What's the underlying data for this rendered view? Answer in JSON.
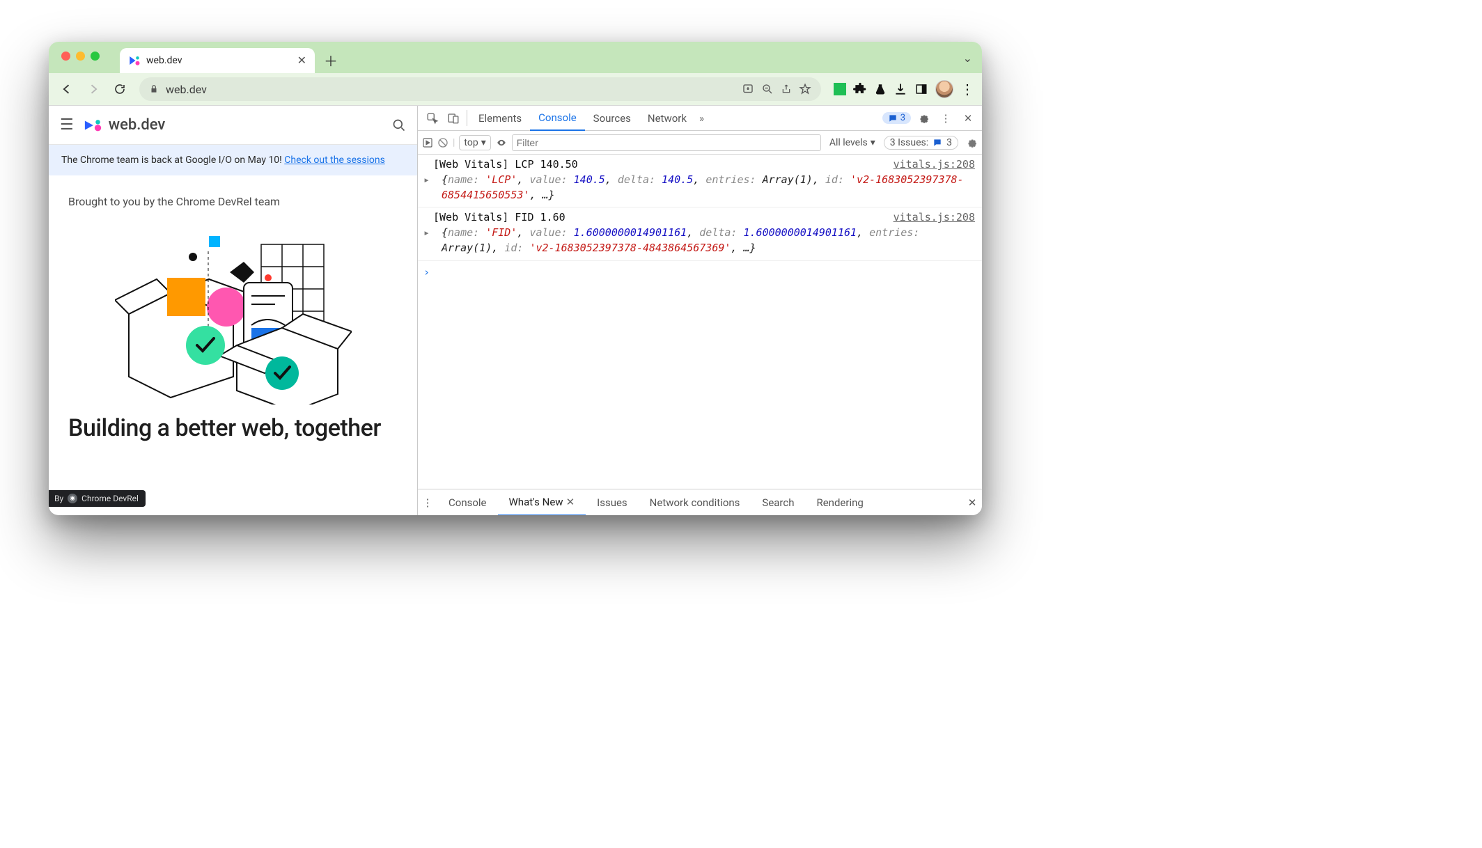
{
  "browser": {
    "tab_title": "web.dev",
    "omnibox_text": "web.dev",
    "lock_label": "Secure",
    "icons": {
      "back": "back-icon",
      "forward": "forward-icon",
      "reload": "reload-icon",
      "install": "install-icon",
      "zoom": "zoom-out-icon",
      "share": "share-icon",
      "star": "star-icon",
      "extension_square": "extension-square-icon",
      "extensions_puzzle": "puzzle-icon",
      "labs": "flask-icon",
      "downloads": "download-icon",
      "window_toggle": "panel-icon",
      "menu": "kebab-icon"
    }
  },
  "page": {
    "brand": "web.dev",
    "banner_text": "The Chrome team is back at Google I/O on May 10! ",
    "banner_link": "Check out the sessions",
    "kicker": "Brought to you by the Chrome DevRel team",
    "heading": "Building a better web, together",
    "badge_by": "By",
    "badge_name": "Chrome DevRel"
  },
  "devtools": {
    "tabs": [
      "Elements",
      "Console",
      "Sources",
      "Network"
    ],
    "selected_tab": "Console",
    "overflow_glyph": "»",
    "message_count": "3",
    "toolbar": {
      "context": "top",
      "filter_placeholder": "Filter",
      "levels_label": "All levels",
      "issues_prefix": "3 Issues:",
      "issues_count": "3"
    },
    "logs": [
      {
        "source": "vitals.js:208",
        "title": "[Web Vitals] LCP 140.50",
        "obj": {
          "name": "'LCP'",
          "value": "140.5",
          "delta": "140.5",
          "entries": "Array(1)",
          "id": "'v2-1683052397378-6854415650553'",
          "rest": "…"
        }
      },
      {
        "source": "vitals.js:208",
        "title": "[Web Vitals] FID 1.60",
        "obj": {
          "name": "'FID'",
          "value": "1.6000000014901161",
          "delta": "1.6000000014901161",
          "entries": "Array(1)",
          "id": "'v2-1683052397378-4843864567369'",
          "rest": "…"
        }
      }
    ],
    "drawer": {
      "tabs": [
        "Console",
        "What's New",
        "Issues",
        "Network conditions",
        "Search",
        "Rendering"
      ],
      "selected": "What's New"
    }
  }
}
